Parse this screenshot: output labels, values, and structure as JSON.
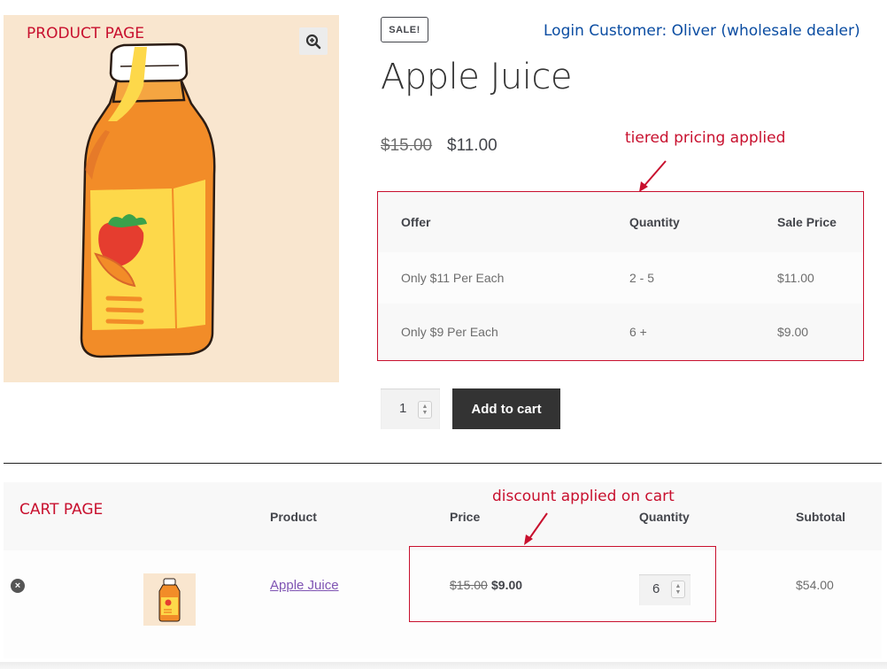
{
  "annotations": {
    "product_page": "PRODUCT PAGE",
    "login_customer": "Login Customer: Oliver (wholesale dealer)",
    "tiered_pricing": "tiered pricing applied",
    "cart_page": "CART PAGE",
    "discount_applied": "discount applied on cart"
  },
  "product": {
    "sale_badge": "SALE!",
    "title": "Apple Juice",
    "regular_price": "$15.00",
    "sale_price": "$11.00",
    "quantity": "1",
    "add_to_cart_label": "Add to cart",
    "image_icon": "apple-juice-bottle-image",
    "zoom_icon": "magnify-plus-icon"
  },
  "tier_table": {
    "headers": [
      "Offer",
      "Quantity",
      "Sale Price"
    ],
    "rows": [
      [
        "Only $11 Per Each",
        "2 - 5",
        "$11.00"
      ],
      [
        "Only $9 Per Each",
        "6 +",
        "$9.00"
      ]
    ]
  },
  "cart": {
    "headers": {
      "product": "Product",
      "price": "Price",
      "quantity": "Quantity",
      "subtotal": "Subtotal"
    },
    "item": {
      "name": "Apple Juice",
      "regular_price": "$15.00",
      "price": "$9.00",
      "quantity": "6",
      "subtotal": "$54.00"
    },
    "remove_icon": "remove-circle-x-icon"
  },
  "colors": {
    "annotation_red": "#c8102e",
    "annotation_blue": "#0b4da2",
    "button_dark": "#333333",
    "image_bg": "#f9e6cf",
    "link_purple": "#7f54b3"
  }
}
